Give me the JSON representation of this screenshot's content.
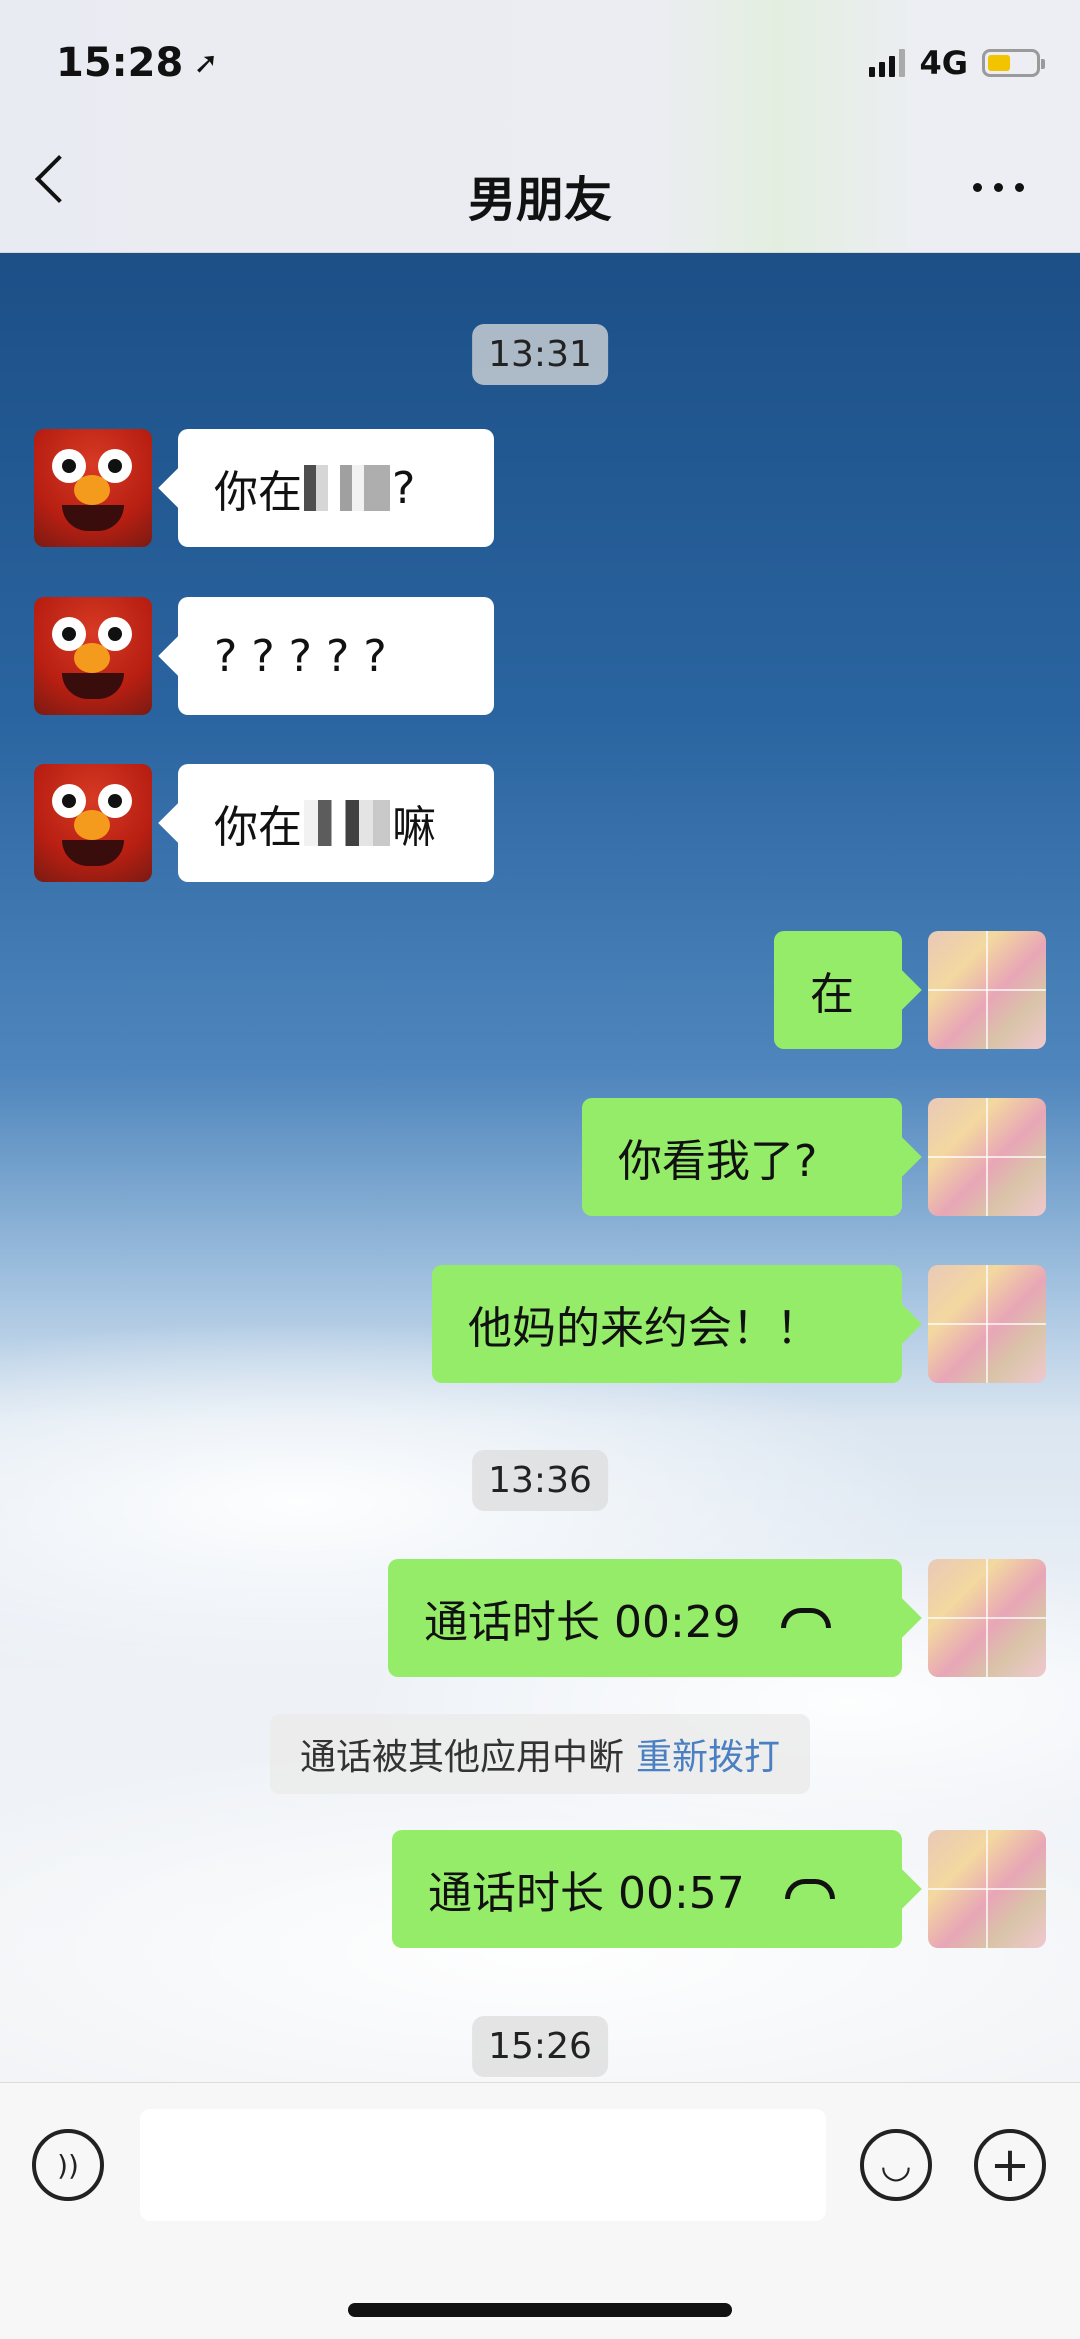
{
  "status": {
    "time": "15:28",
    "network": "4G"
  },
  "nav": {
    "title": "男朋友"
  },
  "timestamps": [
    "13:31",
    "13:36",
    "15:26"
  ],
  "messages": [
    {
      "side": "left",
      "text_before": "你在",
      "text_after": "?"
    },
    {
      "side": "left",
      "text": "? ? ? ? ?"
    },
    {
      "side": "left",
      "text_before": "你在",
      "text_after": "嘛"
    },
    {
      "side": "right",
      "text": "在"
    },
    {
      "side": "right",
      "text": "你看我了?"
    },
    {
      "side": "right",
      "text": "他妈的来约会！！"
    },
    {
      "side": "right",
      "text": "通话时长 00:29"
    },
    {
      "side": "right",
      "text": "通话时长 00:57"
    }
  ],
  "system": {
    "text": "通话被其他应用中断",
    "link": "重新拨打"
  },
  "input": {
    "value": ""
  },
  "icons": {
    "voice": "voice-icon",
    "emoji": "emoji-icon",
    "add": "plus-icon",
    "back": "back-icon",
    "more": "more-icon",
    "hangup": "phone-hangup-icon"
  },
  "colors": {
    "sent_bubble": "#95ec69",
    "received_bubble": "#ffffff",
    "link": "#4a7fc1"
  }
}
